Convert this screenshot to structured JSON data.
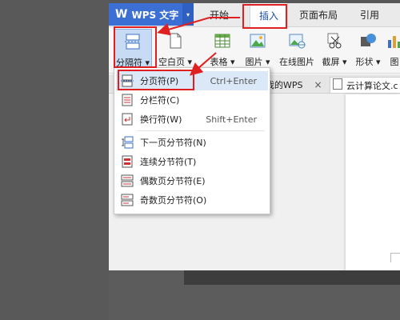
{
  "app": {
    "name": "WPS 文字",
    "logo_glyph": "W",
    "caret": "▾",
    "brand_color": "#3b6fd4"
  },
  "menu_tabs": [
    {
      "label": "开始"
    },
    {
      "label": "插入"
    },
    {
      "label": "页面布局"
    },
    {
      "label": "引用"
    }
  ],
  "ribbon": {
    "break_button": {
      "label": "分隔符 ▾",
      "icon": "page-break-icon"
    },
    "blank_page": {
      "label": "空白页 ▾",
      "icon": "blank-page-icon"
    },
    "table": {
      "label": "表格 ▾",
      "icon": "table-icon"
    },
    "picture": {
      "label": "图片 ▾",
      "icon": "picture-icon"
    },
    "online_picture": {
      "label": "在线图片",
      "icon": "online-picture-icon"
    },
    "screenshot": {
      "label": "截屏 ▾",
      "icon": "scissors-icon"
    },
    "shape": {
      "label": "形状 ▾",
      "icon": "shape-icon"
    },
    "chart": {
      "label": "图",
      "icon": "chart-icon"
    }
  },
  "doc_tabs": [
    {
      "label": "我的WPS",
      "close": "×"
    },
    {
      "label": "云计算论文.c"
    }
  ],
  "dropdown": {
    "items": [
      {
        "label": "分页符(P)",
        "shortcut": "Ctrl+Enter",
        "icon": "page-break-icon",
        "highlighted": true
      },
      {
        "label": "分栏符(C)",
        "shortcut": "",
        "icon": "column-break-icon"
      },
      {
        "label": "换行符(W)",
        "shortcut": "Shift+Enter",
        "icon": "line-break-icon"
      },
      {
        "label": "下一页分节符(N)",
        "shortcut": "",
        "icon": "next-page-section-icon"
      },
      {
        "label": "连续分节符(T)",
        "shortcut": "",
        "icon": "continuous-section-icon"
      },
      {
        "label": "偶数页分节符(E)",
        "shortcut": "",
        "icon": "even-page-section-icon"
      },
      {
        "label": "奇数页分节符(O)",
        "shortcut": "",
        "icon": "odd-page-section-icon"
      }
    ]
  },
  "colors": {
    "highlight_red": "#e02020",
    "menu_highlight": "#dbe8f7",
    "pressed": "#c7dcf4"
  }
}
